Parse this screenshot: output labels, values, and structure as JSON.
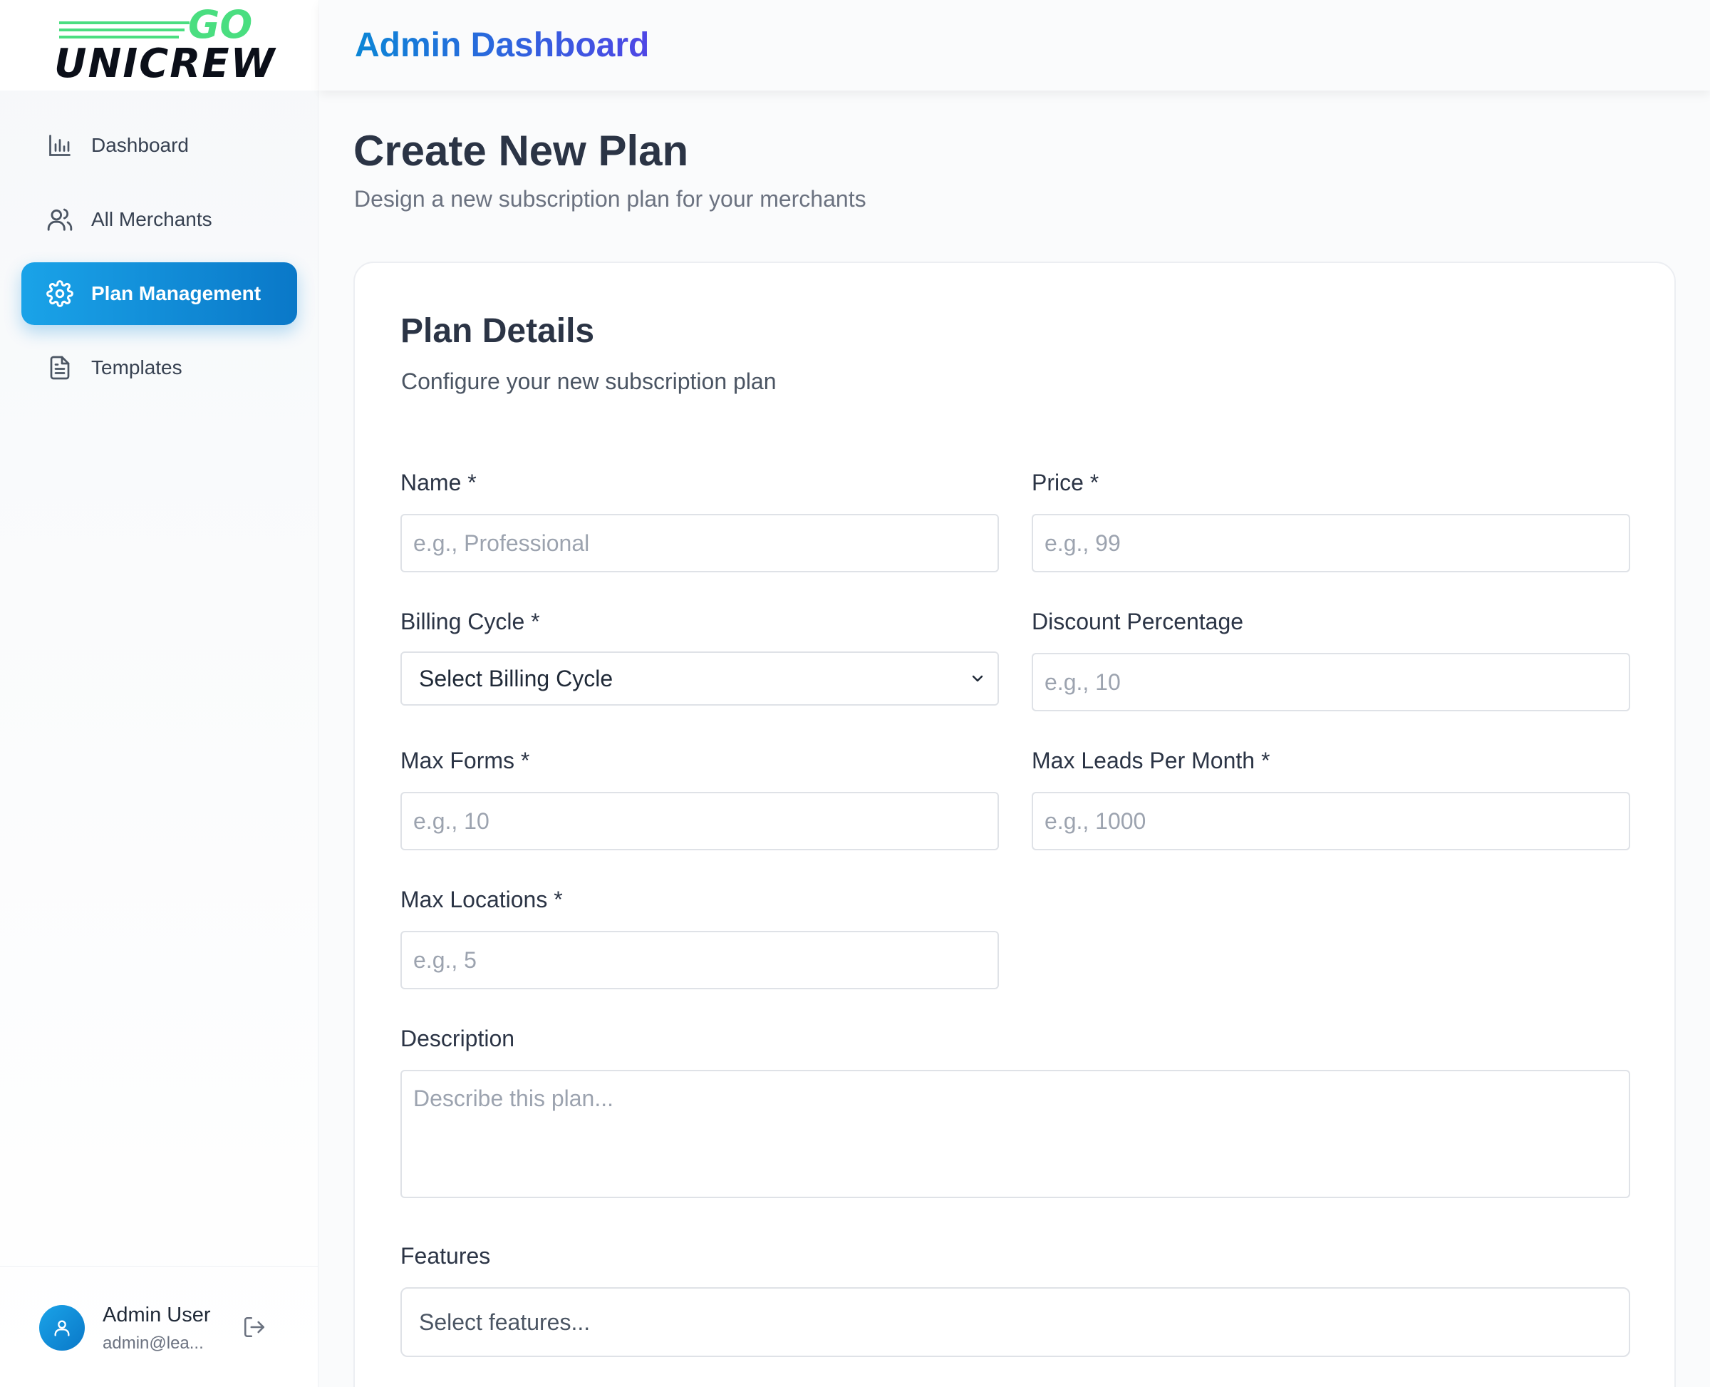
{
  "brand": {
    "wordmark": "UNICREW",
    "accent": "GO",
    "accent_color": "#4ade80"
  },
  "header": {
    "title": "Admin Dashboard"
  },
  "sidebar": {
    "items": [
      {
        "label": "Dashboard",
        "icon": "bar-chart-icon",
        "active": false
      },
      {
        "label": "All Merchants",
        "icon": "users-icon",
        "active": false
      },
      {
        "label": "Plan Management",
        "icon": "gear-icon",
        "active": true
      },
      {
        "label": "Templates",
        "icon": "document-icon",
        "active": false
      }
    ],
    "user": {
      "name": "Admin User",
      "email": "admin@lea..."
    }
  },
  "page": {
    "title": "Create New Plan",
    "subtitle": "Design a new subscription plan for your merchants"
  },
  "card": {
    "title": "Plan Details",
    "subtitle": "Configure your new subscription plan"
  },
  "form": {
    "name": {
      "label": "Name *",
      "placeholder": "e.g., Professional"
    },
    "price": {
      "label": "Price *",
      "placeholder": "e.g., 99"
    },
    "billing_cycle": {
      "label": "Billing Cycle *",
      "value": "Select Billing Cycle"
    },
    "discount": {
      "label": "Discount Percentage",
      "placeholder": "e.g., 10"
    },
    "max_forms": {
      "label": "Max Forms *",
      "placeholder": "e.g., 10"
    },
    "max_leads": {
      "label": "Max Leads Per Month *",
      "placeholder": "e.g., 1000"
    },
    "max_locations": {
      "label": "Max Locations *",
      "placeholder": "e.g., 5"
    },
    "description": {
      "label": "Description",
      "placeholder": "Describe this plan..."
    },
    "features": {
      "label": "Features",
      "placeholder": "Select features..."
    }
  },
  "colors": {
    "accent": "#1aa3e8",
    "accent_dark": "#0a78c8",
    "title_gradient_end": "#4f46e5"
  }
}
